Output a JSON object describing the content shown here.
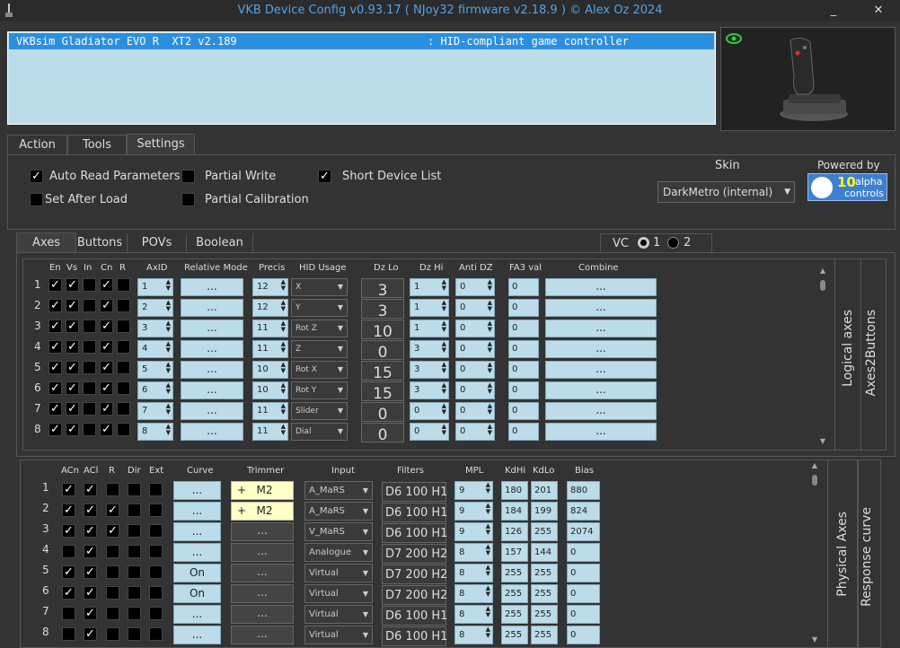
{
  "window": {
    "title": "VKB Device Config v0.93.17 ( NJoy32 firmware v2.18.9 ) © Alex Oz 2024",
    "minimize": "_",
    "close": "✕"
  },
  "device": {
    "name": "VKBsim Gladiator EVO R  XT2 v2.189",
    "type": ": HID-compliant game controller"
  },
  "main_tabs": [
    "Action",
    "Tools",
    "Settings"
  ],
  "settings": {
    "auto_read": "Auto Read Parameters",
    "partial_write": "Partial Write",
    "short_list": "Short Device List",
    "set_after_load": "Set After Load",
    "partial_calib": "Partial Calibration",
    "skin_label": "Skin",
    "skin_value": "DarkMetro (internal)",
    "powered_by": "Powered by",
    "alpha_num": "10",
    "alpha_line1": "alpha",
    "alpha_line2": "controls"
  },
  "sub_tabs": [
    "Axes",
    "Buttons",
    "POVs",
    "Boolean"
  ],
  "vc": {
    "label": "VC",
    "opt1": "1",
    "opt2": "2"
  },
  "logical": {
    "headers": {
      "en": "En",
      "vs": "Vs",
      "in": "In",
      "cn": "Cn",
      "r": "R",
      "axid": "AxID",
      "relmode": "Relative Mode",
      "precis": "Precis",
      "hid": "HID Usage",
      "dzlo": "Dz Lo",
      "dzhi": "Dz Hi",
      "antidz": "Anti DZ",
      "fa3": "FA3 val",
      "combine": "Combine"
    },
    "side1": "Logical axes",
    "side2": "Axes2Buttons",
    "dots": "...",
    "rows": [
      {
        "n": "1",
        "en": true,
        "vs": true,
        "in": false,
        "cn": true,
        "r": false,
        "axid": "1",
        "precis": "12",
        "hid": "X",
        "dzlo": "3",
        "dzhi": "1",
        "anti": "0",
        "fa3": "0"
      },
      {
        "n": "2",
        "en": true,
        "vs": true,
        "in": false,
        "cn": true,
        "r": false,
        "axid": "2",
        "precis": "12",
        "hid": "Y",
        "dzlo": "3",
        "dzhi": "1",
        "anti": "0",
        "fa3": "0"
      },
      {
        "n": "3",
        "en": true,
        "vs": true,
        "in": false,
        "cn": true,
        "r": false,
        "axid": "3",
        "precis": "11",
        "hid": "Rot Z",
        "dzlo": "10",
        "dzhi": "1",
        "anti": "0",
        "fa3": "0"
      },
      {
        "n": "4",
        "en": true,
        "vs": true,
        "in": false,
        "cn": true,
        "r": false,
        "axid": "4",
        "precis": "11",
        "hid": "Z",
        "dzlo": "0",
        "dzhi": "3",
        "anti": "0",
        "fa3": "0"
      },
      {
        "n": "5",
        "en": true,
        "vs": true,
        "in": false,
        "cn": true,
        "r": false,
        "axid": "5",
        "precis": "10",
        "hid": "Rot X",
        "dzlo": "15",
        "dzhi": "3",
        "anti": "0",
        "fa3": "0"
      },
      {
        "n": "6",
        "en": true,
        "vs": true,
        "in": false,
        "cn": true,
        "r": false,
        "axid": "6",
        "precis": "10",
        "hid": "Rot Y",
        "dzlo": "15",
        "dzhi": "3",
        "anti": "0",
        "fa3": "0"
      },
      {
        "n": "7",
        "en": true,
        "vs": true,
        "in": false,
        "cn": true,
        "r": false,
        "axid": "7",
        "precis": "11",
        "hid": "Slider",
        "dzlo": "0",
        "dzhi": "0",
        "anti": "0",
        "fa3": "0"
      },
      {
        "n": "8",
        "en": true,
        "vs": true,
        "in": false,
        "cn": true,
        "r": false,
        "axid": "8",
        "precis": "11",
        "hid": "Dial",
        "dzlo": "0",
        "dzhi": "0",
        "anti": "0",
        "fa3": "0"
      }
    ]
  },
  "physical": {
    "headers": {
      "acn": "ACn",
      "acl": "ACl",
      "r": "R",
      "dir": "Dir",
      "ext": "Ext",
      "curve": "Curve",
      "trimmer": "Trimmer",
      "input": "Input",
      "filters": "Filters",
      "mpl": "MPL",
      "kdhi": "KdHi",
      "kdlo": "KdLo",
      "bias": "Bias"
    },
    "side1": "Physical Axes",
    "side2": "Response curve",
    "rows": [
      {
        "n": "1",
        "acn": true,
        "acl": true,
        "r": false,
        "dir": false,
        "ext": false,
        "curve": "...",
        "trim": "+   M2",
        "input": "A_MaRS",
        "f1": "D6",
        "f2": "100",
        "f3": "H1",
        "mpl": "9",
        "kdhi": "180",
        "kdlo": "201",
        "bias": "880"
      },
      {
        "n": "2",
        "acn": true,
        "acl": true,
        "r": true,
        "dir": false,
        "ext": false,
        "curve": "...",
        "trim": "+   M2",
        "input": "A_MaRS",
        "f1": "D6",
        "f2": "100",
        "f3": "H1",
        "mpl": "9",
        "kdhi": "184",
        "kdlo": "199",
        "bias": "824"
      },
      {
        "n": "3",
        "acn": true,
        "acl": true,
        "r": true,
        "dir": false,
        "ext": false,
        "curve": "...",
        "trim": "",
        "input": "V_MaRS",
        "f1": "D6",
        "f2": "100",
        "f3": "H1",
        "mpl": "9",
        "kdhi": "126",
        "kdlo": "255",
        "bias": "2074"
      },
      {
        "n": "4",
        "acn": false,
        "acl": true,
        "r": false,
        "dir": false,
        "ext": false,
        "curve": "...",
        "trim": "",
        "input": "Analogue",
        "f1": "D7",
        "f2": "200",
        "f3": "H2",
        "mpl": "8",
        "kdhi": "157",
        "kdlo": "144",
        "bias": "0"
      },
      {
        "n": "5",
        "acn": true,
        "acl": true,
        "r": false,
        "dir": false,
        "ext": false,
        "curve": "On",
        "trim": "",
        "input": "Virtual",
        "f1": "D7",
        "f2": "200",
        "f3": "H2",
        "mpl": "8",
        "kdhi": "255",
        "kdlo": "255",
        "bias": "0"
      },
      {
        "n": "6",
        "acn": true,
        "acl": true,
        "r": false,
        "dir": false,
        "ext": false,
        "curve": "On",
        "trim": "",
        "input": "Virtual",
        "f1": "D7",
        "f2": "200",
        "f3": "H2",
        "mpl": "8",
        "kdhi": "255",
        "kdlo": "255",
        "bias": "0"
      },
      {
        "n": "7",
        "acn": false,
        "acl": true,
        "r": false,
        "dir": false,
        "ext": false,
        "curve": "...",
        "trim": "",
        "input": "Virtual",
        "f1": "D6",
        "f2": "100",
        "f3": "H1",
        "mpl": "8",
        "kdhi": "255",
        "kdlo": "255",
        "bias": "0"
      },
      {
        "n": "8",
        "acn": false,
        "acl": true,
        "r": false,
        "dir": false,
        "ext": false,
        "curve": "...",
        "trim": "",
        "input": "Virtual",
        "f1": "D6",
        "f2": "100",
        "f3": "H1",
        "mpl": "8",
        "kdhi": "255",
        "kdlo": "255",
        "bias": "0"
      }
    ]
  }
}
